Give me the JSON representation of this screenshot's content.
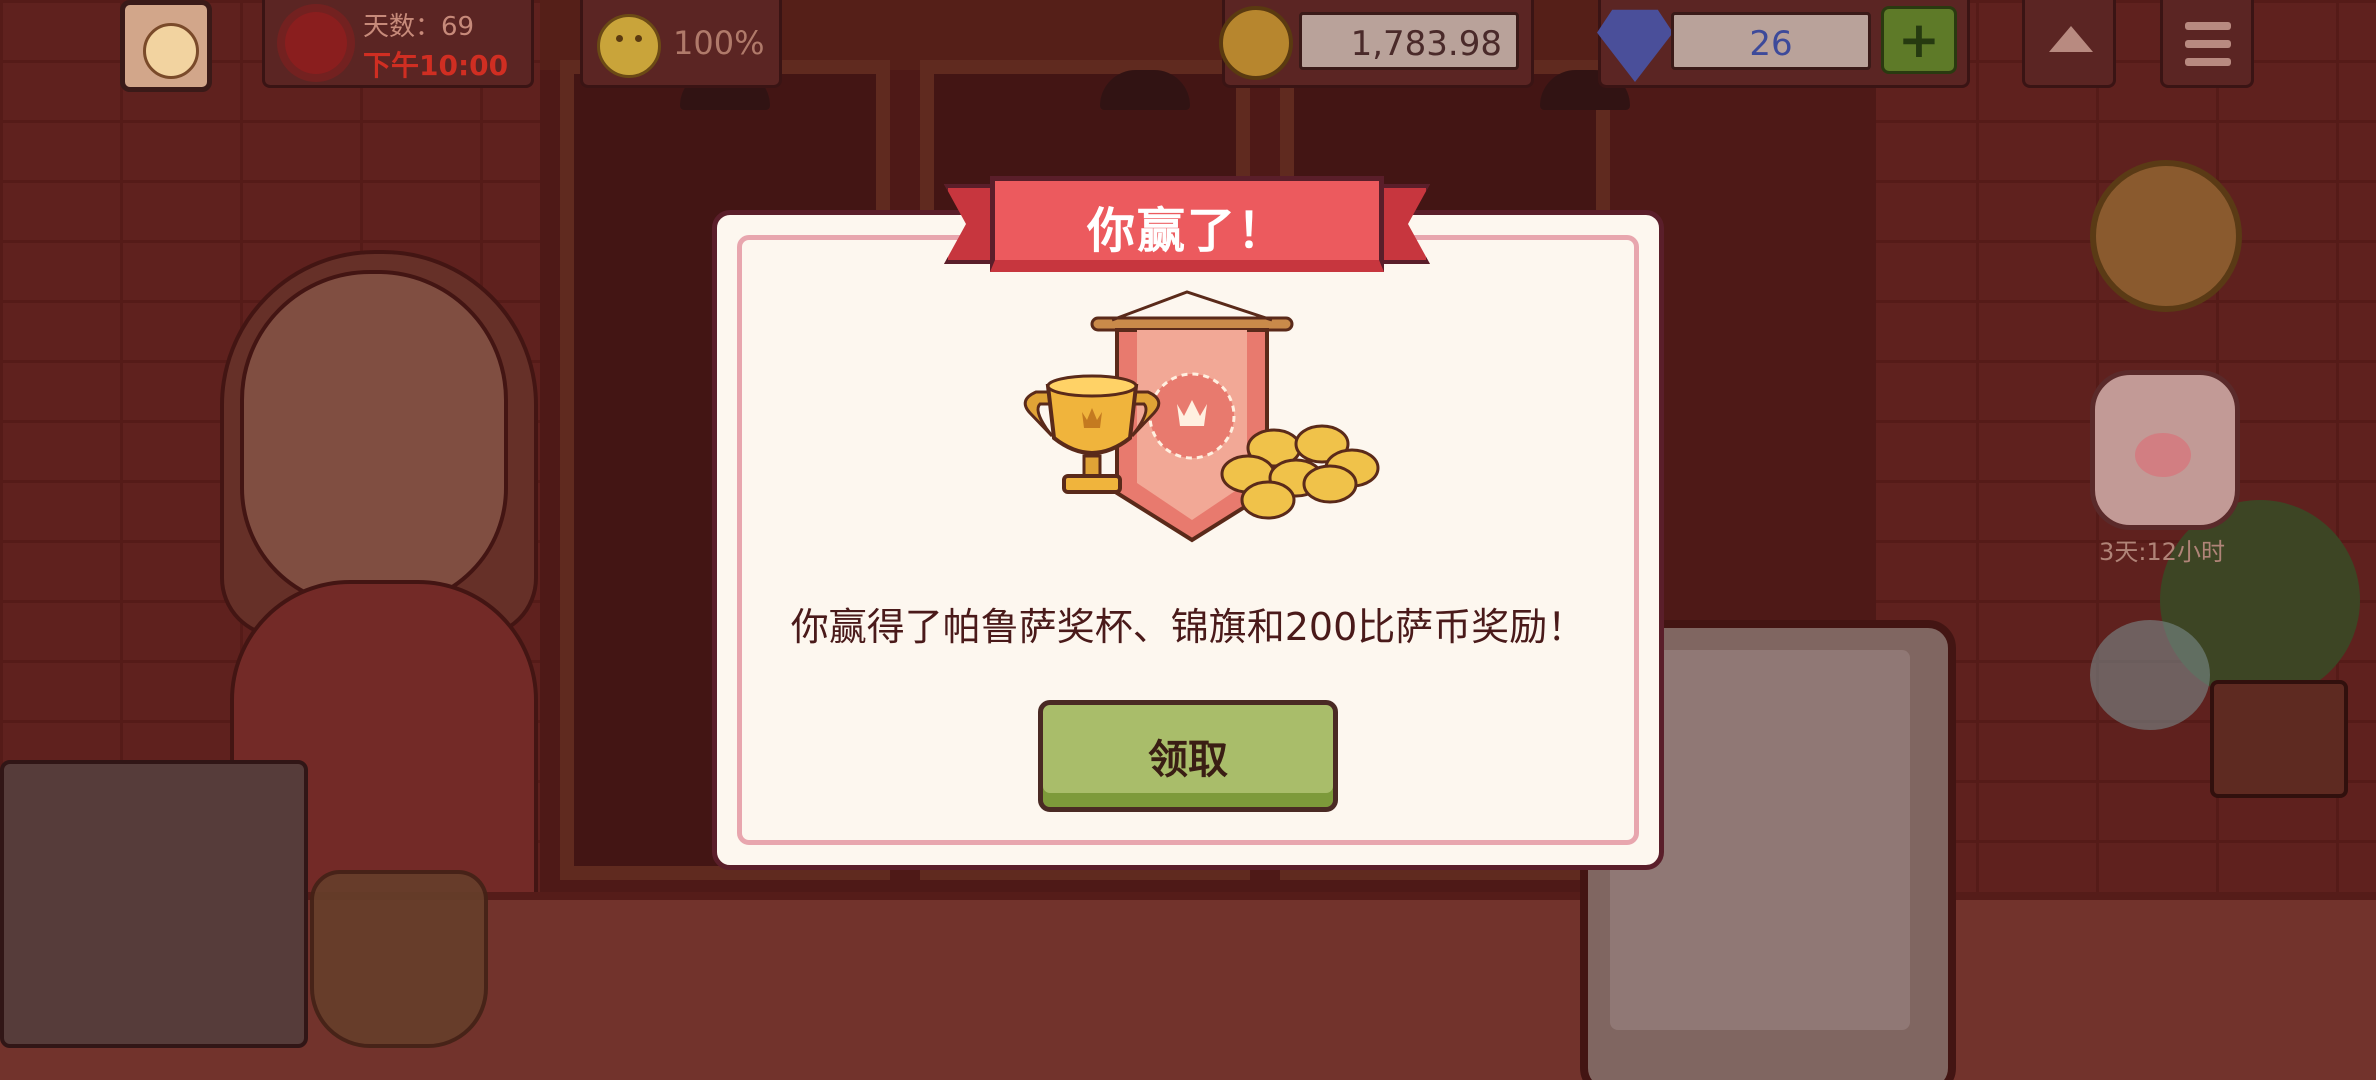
{
  "hud": {
    "day_label": "天数：69",
    "time_label": "下午10:00",
    "mood_value": "100%",
    "coins": "1,783.98",
    "gems": "26",
    "plus_label": "+"
  },
  "side": {
    "timer_label": "3天:12小时"
  },
  "dialog": {
    "title": "你赢了！",
    "message": "你赢得了帕鲁萨奖杯、锦旗和200比萨币奖励！",
    "claim_label": "领取"
  },
  "colors": {
    "ribbon": "#ec5a5e",
    "claim_button": "#a9bd6a",
    "dialog_bg": "#fdf7ef"
  }
}
